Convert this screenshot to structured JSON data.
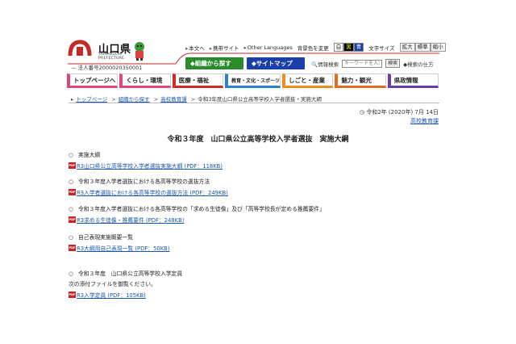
{
  "header": {
    "pref_name": "山口県",
    "pref_name_en": "YAMAGUCHI\nPREFECTURE",
    "corp_number": "法人番号2000020350001",
    "util_links": [
      "本文へ",
      "携帯サイト",
      "Other Languages"
    ],
    "bg_color_label": "背景色を変更",
    "bg_colors": [
      "白",
      "黒",
      "青"
    ],
    "text_size_label": "文字サイズ",
    "text_sizes": [
      "拡大",
      "標準",
      "縮小"
    ],
    "org_search_btn": "組織から探す",
    "sitemap_btn": "サイトマップ",
    "info_search_label": "情報検索",
    "keyword_placeholder": "キーワードを入力",
    "search_btn": "検索",
    "search_howto": "検索の仕方"
  },
  "nav": [
    "トップページへ",
    "くらし・環境",
    "医療・福祉",
    "教育・文化・スポーツ",
    "しごと・産業",
    "魅力・観光",
    "県政情報"
  ],
  "nav_colors": [
    "#e0457b",
    "#e0457b",
    "#d62828",
    "#2b7fd6",
    "#f08c1e",
    "#e06d1e",
    "#6a3db0"
  ],
  "breadcrumb": {
    "items": [
      "トップページ",
      "組織から探す",
      "高校教育課"
    ],
    "current": "令和3年度山口県公立高等学校入学者選抜・実施大綱"
  },
  "date": "令和2年 (2020年) 7月 14日",
  "dept": "高校教育課",
  "title": "令和３年度　山口県公立高等学校入学者選抜　実施大綱",
  "sections": [
    {
      "head": "実施大綱",
      "link": "R3山口県公立高等学校入学者選抜実施大綱 (PDF：118KB)"
    },
    {
      "head": "令和３年度入学者選抜における各高等学校の選抜方法",
      "link": "R3入学者選抜における各高等学校の選抜方法 (PDF：249KB)"
    },
    {
      "head": "令和３年度入学者選抜における各高等学校の「求める生徒像」及び「高等学校長が定める推薦要件」",
      "link": "R3求める生徒像・推薦要件 (PDF：248KB)"
    },
    {
      "head": "自己表現実施概要一覧",
      "link": "R3大綱用自己表現一覧 (PDF：50KB)"
    },
    {
      "head": "令和３年度　山口県公立高等学校入学定員",
      "note": "次の添付ファイルを御覧ください。",
      "link": "R3入学定員 (PDF：105KB)"
    }
  ],
  "circle_glyph": "○",
  "pdf_icon_text": "PDF"
}
